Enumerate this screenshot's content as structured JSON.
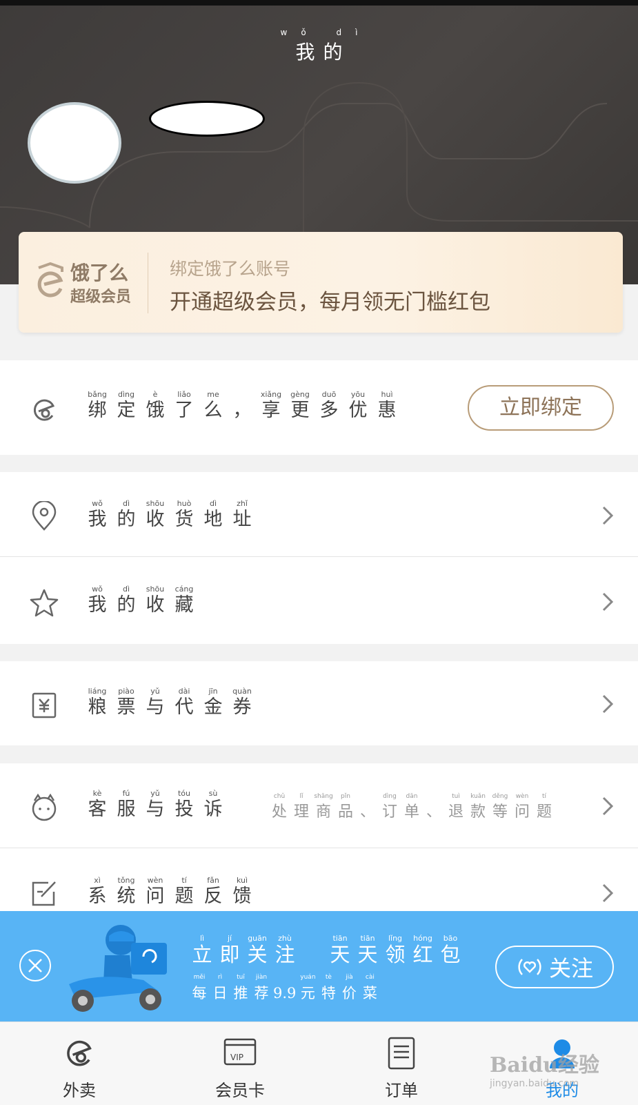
{
  "header": {
    "title_pinyin": "wǒ dì",
    "title": "我的"
  },
  "vip_card": {
    "logo_line1": "饿了么",
    "logo_line2": "超级会员",
    "bind_text": "绑定饿了么账号",
    "promo_text": "开通超级会员，每月领无门槛红包"
  },
  "bind_row": {
    "icon": "eleme-icon",
    "chars": [
      {
        "p": "bǎng",
        "c": "绑"
      },
      {
        "p": "dìng",
        "c": "定"
      },
      {
        "p": "è",
        "c": "饿"
      },
      {
        "p": "liǎo",
        "c": "了"
      },
      {
        "p": "me",
        "c": "么"
      },
      {
        "p": "",
        "c": "，"
      },
      {
        "p": "xiǎng",
        "c": "享"
      },
      {
        "p": "gèng",
        "c": "更"
      },
      {
        "p": "duō",
        "c": "多"
      },
      {
        "p": "yōu",
        "c": "优"
      },
      {
        "p": "huì",
        "c": "惠"
      }
    ],
    "button_label": "立即绑定"
  },
  "menu": {
    "address": {
      "icon": "location-pin-icon",
      "chars": [
        {
          "p": "wǒ",
          "c": "我"
        },
        {
          "p": "dì",
          "c": "的"
        },
        {
          "p": "shōu",
          "c": "收"
        },
        {
          "p": "huò",
          "c": "货"
        },
        {
          "p": "dì",
          "c": "地"
        },
        {
          "p": "zhǐ",
          "c": "址"
        }
      ]
    },
    "favorites": {
      "icon": "star-icon",
      "chars": [
        {
          "p": "wǒ",
          "c": "我"
        },
        {
          "p": "dì",
          "c": "的"
        },
        {
          "p": "shōu",
          "c": "收"
        },
        {
          "p": "cáng",
          "c": "藏"
        }
      ]
    },
    "coupons": {
      "icon": "yen-voucher-icon",
      "chars": [
        {
          "p": "liáng",
          "c": "粮"
        },
        {
          "p": "piào",
          "c": "票"
        },
        {
          "p": "yǔ",
          "c": "与"
        },
        {
          "p": "dài",
          "c": "代"
        },
        {
          "p": "jīn",
          "c": "金"
        },
        {
          "p": "quàn",
          "c": "券"
        }
      ]
    },
    "service": {
      "icon": "customer-service-icon",
      "chars": [
        {
          "p": "kè",
          "c": "客"
        },
        {
          "p": "fú",
          "c": "服"
        },
        {
          "p": "yǔ",
          "c": "与"
        },
        {
          "p": "tóu",
          "c": "投"
        },
        {
          "p": "sù",
          "c": "诉"
        }
      ],
      "hint_chars": [
        {
          "p": "chǔ",
          "c": "处"
        },
        {
          "p": "lǐ",
          "c": "理"
        },
        {
          "p": "shāng",
          "c": "商"
        },
        {
          "p": "pǐn",
          "c": "品"
        },
        {
          "p": "",
          "c": "、"
        },
        {
          "p": "dìng",
          "c": "订"
        },
        {
          "p": "dān",
          "c": "单"
        },
        {
          "p": "",
          "c": "、"
        },
        {
          "p": "tuì",
          "c": "退"
        },
        {
          "p": "kuǎn",
          "c": "款"
        },
        {
          "p": "děng",
          "c": "等"
        },
        {
          "p": "wèn",
          "c": "问"
        },
        {
          "p": "tí",
          "c": "题"
        }
      ]
    },
    "feedback": {
      "icon": "edit-feedback-icon",
      "chars": [
        {
          "p": "xì",
          "c": "系"
        },
        {
          "p": "tǒng",
          "c": "统"
        },
        {
          "p": "wèn",
          "c": "问"
        },
        {
          "p": "tí",
          "c": "题"
        },
        {
          "p": "fǎn",
          "c": "反"
        },
        {
          "p": "kuì",
          "c": "馈"
        }
      ]
    }
  },
  "follow_banner": {
    "line1": [
      {
        "p": "lì",
        "c": "立"
      },
      {
        "p": "jí",
        "c": "即"
      },
      {
        "p": "guān",
        "c": "关"
      },
      {
        "p": "zhù",
        "c": "注"
      },
      {
        "p": "",
        "c": " "
      },
      {
        "p": "tiān",
        "c": "天"
      },
      {
        "p": "tiān",
        "c": "天"
      },
      {
        "p": "lǐng",
        "c": "领"
      },
      {
        "p": "hóng",
        "c": "红"
      },
      {
        "p": "bāo",
        "c": "包"
      }
    ],
    "line2": [
      {
        "p": "měi",
        "c": "每"
      },
      {
        "p": "rì",
        "c": "日"
      },
      {
        "p": "tuī",
        "c": "推"
      },
      {
        "p": "jiàn",
        "c": "荐"
      },
      {
        "p": "",
        "c": "9.9"
      },
      {
        "p": "yuán",
        "c": "元"
      },
      {
        "p": "tè",
        "c": "特"
      },
      {
        "p": "jià",
        "c": "价"
      },
      {
        "p": "cài",
        "c": "菜"
      }
    ],
    "button_label": "关注",
    "close_icon": "close-circle-icon"
  },
  "tabbar": {
    "tabs": [
      {
        "label": "外卖",
        "icon": "eleme-icon",
        "active": false
      },
      {
        "label": "会员卡",
        "icon": "vip-card-icon",
        "active": false
      },
      {
        "label": "订单",
        "icon": "order-list-icon",
        "active": false
      },
      {
        "label": "我的",
        "icon": "profile-icon",
        "active": true
      }
    ]
  },
  "watermark": {
    "line1": "Baidu经验",
    "line2": "jingyan.baidu.com"
  },
  "colors": {
    "accent_blue": "#1e8be6",
    "banner_blue": "#58b4f5",
    "gold": "#8d7358",
    "header_dark": "#3e3b3a"
  }
}
